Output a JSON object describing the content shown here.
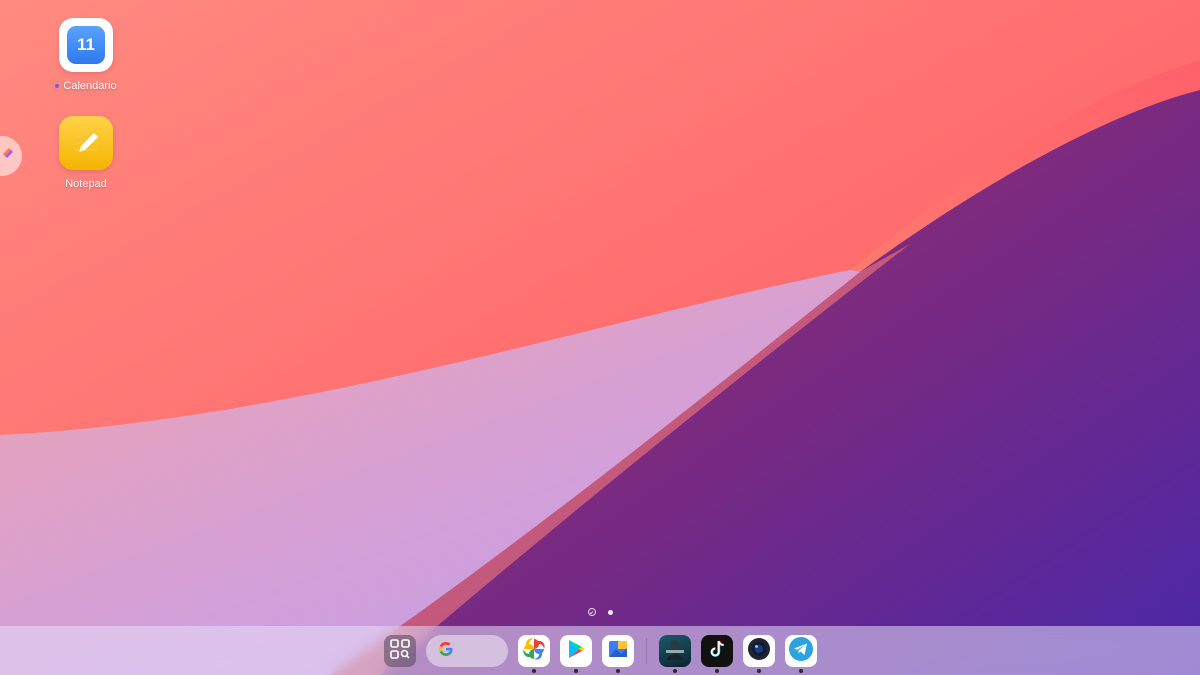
{
  "desktop": {
    "icons": [
      {
        "label": "Calendario",
        "badge_text": "11",
        "icon": "calendar-icon",
        "has_new_dot": true
      },
      {
        "label": "Notepad",
        "icon": "notepad-pencil-icon",
        "has_new_dot": false
      }
    ],
    "side_handle_icon": "sidebar-tools-icon",
    "pager": {
      "pages": 1,
      "current": 1
    }
  },
  "dock": {
    "apps": [
      {
        "name": "app-drawer",
        "icon": "app-grid-search-icon",
        "running": false
      },
      {
        "name": "google-search",
        "icon": "google-g-icon",
        "running": false
      },
      {
        "name": "google-photos",
        "icon": "pinwheel-icon",
        "running": true
      },
      {
        "name": "play-store",
        "icon": "play-triangle-icon",
        "running": true
      },
      {
        "name": "gallery",
        "icon": "gallery-icon",
        "running": true
      },
      {
        "name": "game",
        "icon": "game-soldier-icon",
        "running": true
      },
      {
        "name": "tiktok",
        "icon": "tiktok-note-icon",
        "running": true
      },
      {
        "name": "camera",
        "icon": "camera-lens-icon",
        "running": true
      },
      {
        "name": "telegram",
        "icon": "paper-plane-icon",
        "running": true
      }
    ]
  },
  "colors": {
    "wallpaper_coral": "#ff6a6a",
    "wallpaper_purple": "#6a2a8a",
    "wallpaper_lavender": "#c9a8f0",
    "dock_bg": "#e6defa"
  }
}
